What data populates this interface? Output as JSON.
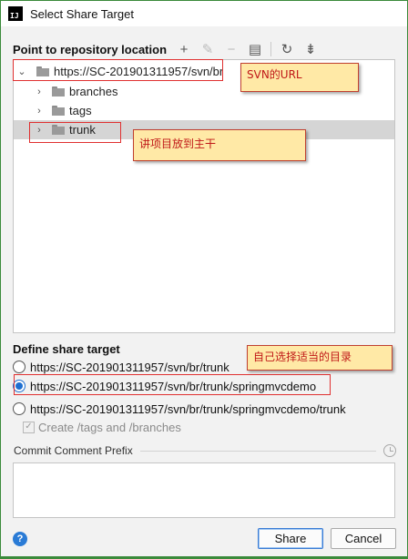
{
  "window": {
    "title": "Select Share Target",
    "app_icon_text": "IJ"
  },
  "repo_section": {
    "label": "Point to repository location",
    "toolbar": [
      {
        "name": "add-icon",
        "glyph": "+",
        "enabled": true
      },
      {
        "name": "edit-icon",
        "glyph": "✎",
        "enabled": false
      },
      {
        "name": "remove-icon",
        "glyph": "−",
        "enabled": false
      },
      {
        "name": "browse-icon",
        "glyph": "▤",
        "enabled": true
      },
      {
        "name": "refresh-icon",
        "glyph": "↻",
        "enabled": true
      },
      {
        "name": "collapse-icon",
        "glyph": "⇟",
        "enabled": true
      }
    ]
  },
  "tree": {
    "root": "https://SC-201901311957/svn/br",
    "children": [
      "branches",
      "tags",
      "trunk"
    ]
  },
  "callouts": {
    "url": "SVN的URL",
    "trunk": "讲项目放到主干",
    "target": "自己选择适当的目录"
  },
  "share_target": {
    "label": "Define share target",
    "options": [
      "https://SC-201901311957/svn/br/trunk",
      "https://SC-201901311957/svn/br/trunk/springmvcdemo",
      "https://SC-201901311957/svn/br/trunk/springmvcdemo/trunk"
    ],
    "selected_index": 1,
    "create_dirs_label": "Create /tags and /branches",
    "create_dirs_checked": true
  },
  "comment": {
    "label": "Commit Comment Prefix",
    "value": ""
  },
  "buttons": {
    "help": "?",
    "share": "Share",
    "cancel": "Cancel"
  },
  "colors": {
    "accent": "#1e6fd0",
    "callout_bg": "#ffe9a6",
    "callout_text": "#c01818",
    "frame": "#3a8a3a"
  }
}
